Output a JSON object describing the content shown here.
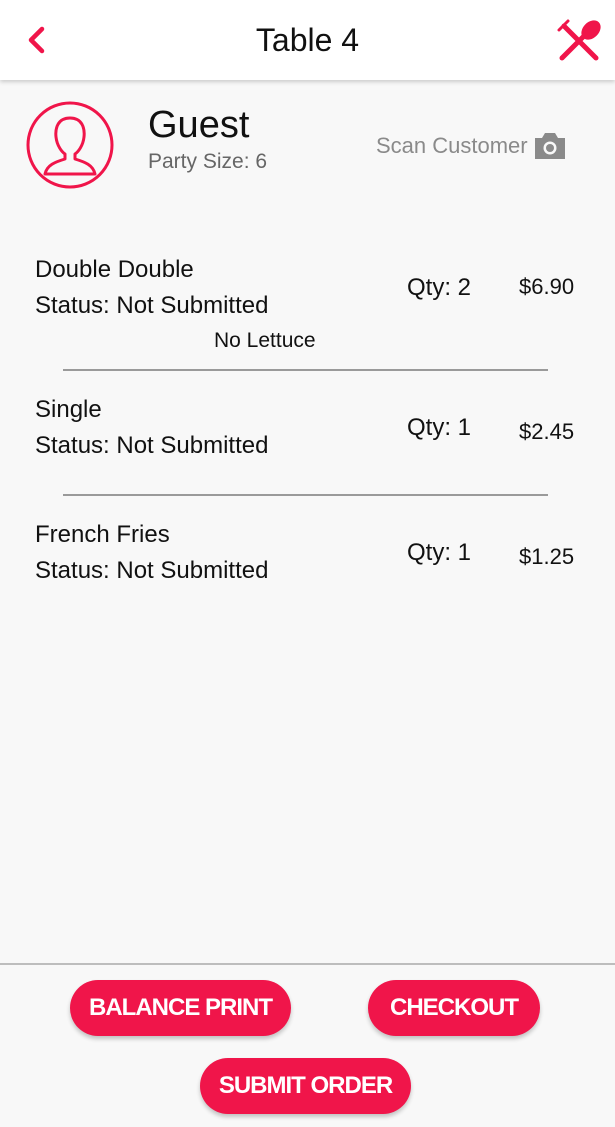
{
  "header": {
    "title": "Table 4",
    "back_icon": "chevron-left-icon",
    "menu_icon": "fork-knife-icon",
    "accent": "#f0154a"
  },
  "guest": {
    "name": "Guest",
    "party_size": "Party Size: 6",
    "scan_label": "Scan Customer",
    "scan_icon": "camera-icon"
  },
  "items": [
    {
      "name": "Double Double",
      "status": "Status: Not Submitted",
      "qty": "Qty: 2",
      "price": "$6.90",
      "note": "No Lettuce"
    },
    {
      "name": "Single",
      "status": "Status: Not Submitted",
      "qty": "Qty: 1",
      "price": "$2.45"
    },
    {
      "name": "French Fries",
      "status": "Status: Not Submitted",
      "qty": "Qty: 1",
      "price": "$1.25"
    }
  ],
  "actions": {
    "balance_print": "BALANCE PRINT",
    "checkout": "CHECKOUT",
    "submit_order": "SUBMIT ORDER"
  }
}
